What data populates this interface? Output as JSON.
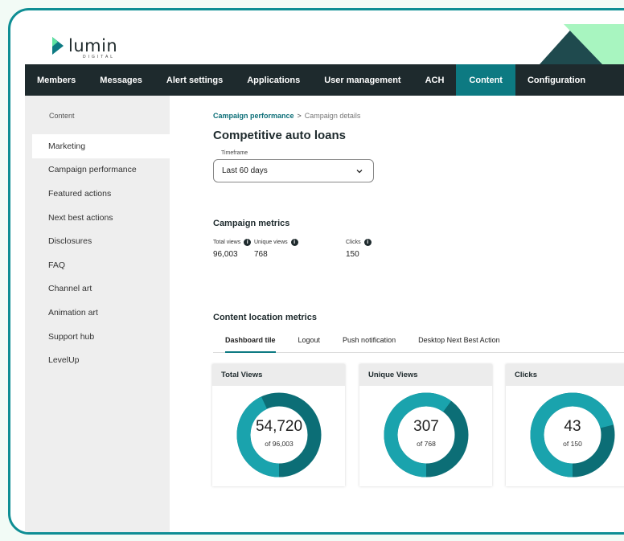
{
  "brand": {
    "name": "lumin",
    "tagline": "DIGITAL",
    "accent": "#0d7a82",
    "nav_bg": "#1e2a2d"
  },
  "nav": {
    "items": [
      "Members",
      "Messages",
      "Alert settings",
      "Applications",
      "User management",
      "ACH",
      "Content",
      "Configuration"
    ],
    "active": "Content"
  },
  "sidebar": {
    "heading": "Content",
    "items": [
      "Marketing",
      "Campaign performance",
      "Featured actions",
      "Next best actions",
      "Disclosures",
      "FAQ",
      "Channel art",
      "Animation art",
      "Support hub",
      "LevelUp"
    ],
    "active": "Marketing"
  },
  "breadcrumb": {
    "link": "Campaign performance",
    "separator": ">",
    "current": "Campaign details"
  },
  "page_title": "Competitive auto loans",
  "timeframe": {
    "label": "Timeframe",
    "value": "Last 60 days"
  },
  "campaign_metrics": {
    "heading": "Campaign metrics",
    "items": [
      {
        "label": "Total views",
        "value": "96,003"
      },
      {
        "label": "Unique views",
        "value": "768"
      },
      {
        "label": "Clicks",
        "value": "150"
      }
    ]
  },
  "content_location": {
    "heading": "Content location metrics",
    "tabs": [
      "Dashboard tile",
      "Logout",
      "Push notification",
      "Desktop Next Best Action"
    ],
    "active_tab": "Dashboard tile"
  },
  "cards": [
    {
      "title": "Total Views",
      "value": "54,720",
      "of_label": "of 96,003",
      "fraction": 0.57
    },
    {
      "title": "Unique Views",
      "value": "307",
      "of_label": "of 768",
      "fraction": 0.4
    },
    {
      "title": "Clicks",
      "value": "43",
      "of_label": "of 150",
      "fraction": 0.29
    }
  ],
  "donut_colors": {
    "filled": "#1aa3ad",
    "rest": "#0c6e76"
  }
}
